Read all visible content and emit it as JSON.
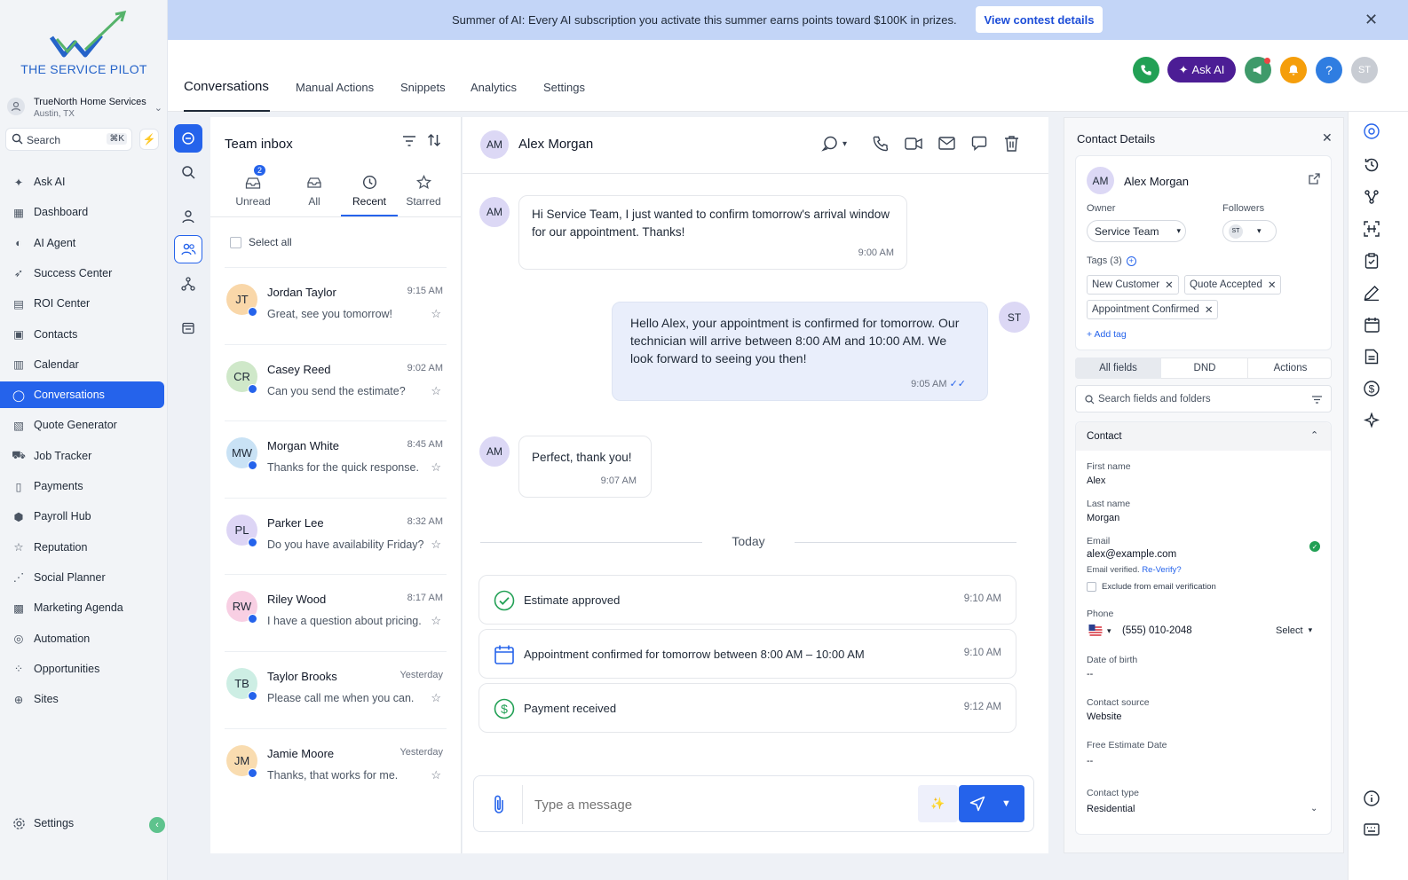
{
  "brand": {
    "name": "THE SERVICE PILOT"
  },
  "account": {
    "name": "TrueNorth Home Services",
    "location": "Austin, TX"
  },
  "sidebar": {
    "search_label": "Search",
    "search_shortcut": "⌘K",
    "items": [
      {
        "label": "Ask AI",
        "icon": "sparkle-icon"
      },
      {
        "label": "Dashboard",
        "icon": "grid-icon"
      },
      {
        "label": "AI Agent",
        "icon": "ai-agent-icon"
      },
      {
        "label": "Success Center",
        "icon": "rocket-icon"
      },
      {
        "label": "ROI Center",
        "icon": "chart-icon"
      },
      {
        "label": "Contacts",
        "icon": "contacts-icon"
      },
      {
        "label": "Calendar",
        "icon": "calendar-icon"
      },
      {
        "label": "Conversations",
        "icon": "chat-icon"
      },
      {
        "label": "Quote Generator",
        "icon": "quote-icon"
      },
      {
        "label": "Job Tracker",
        "icon": "truck-icon"
      },
      {
        "label": "Payments",
        "icon": "receipt-icon"
      },
      {
        "label": "Payroll Hub",
        "icon": "payroll-icon"
      },
      {
        "label": "Reputation",
        "icon": "star-icon"
      },
      {
        "label": "Social Planner",
        "icon": "share-icon"
      },
      {
        "label": "Marketing Agenda",
        "icon": "building-icon"
      },
      {
        "label": "Automation",
        "icon": "automation-icon"
      },
      {
        "label": "Opportunities",
        "icon": "opportunities-icon"
      },
      {
        "label": "Sites",
        "icon": "globe-icon"
      }
    ],
    "settings_label": "Settings"
  },
  "banner": {
    "message": "Summer of AI: Every AI subscription you activate this summer earns points toward $100K in prizes.",
    "cta": "View contest details"
  },
  "topnav": {
    "tabs": [
      "Conversations",
      "Manual Actions",
      "Snippets",
      "Analytics",
      "Settings"
    ],
    "ask_ai": "Ask AI",
    "user_initials": "ST",
    "colors": {
      "phone": "#22a055",
      "askai": "#4c1d95",
      "megaphone": "#3f9a6a",
      "bell": "#f59e0b",
      "help": "#2f7de1"
    }
  },
  "inbox": {
    "title": "Team inbox",
    "tabs": [
      {
        "label": "Unread",
        "badge": "2"
      },
      {
        "label": "All"
      },
      {
        "label": "Recent"
      },
      {
        "label": "Starred"
      }
    ],
    "select_all": "Select all",
    "conversations": [
      {
        "initials": "JT",
        "name": "Jordan Taylor",
        "time": "9:15 AM",
        "preview": "Great, see you tomorrow!",
        "color": "#f9d7a9"
      },
      {
        "initials": "CR",
        "name": "Casey Reed",
        "time": "9:02 AM",
        "preview": "Can you send the estimate?",
        "color": "#cfe8c9"
      },
      {
        "initials": "MW",
        "name": "Morgan White",
        "time": "8:45 AM",
        "preview": "Thanks for the quick response.",
        "color": "#c9e2f5"
      },
      {
        "initials": "PL",
        "name": "Parker Lee",
        "time": "8:32 AM",
        "preview": "Do you have availability Friday?",
        "color": "#ddd5f5"
      },
      {
        "initials": "RW",
        "name": "Riley Wood",
        "time": "8:17 AM",
        "preview": "I have a question about pricing.",
        "color": "#f8cfe3"
      },
      {
        "initials": "TB",
        "name": "Taylor Brooks",
        "time": "Yesterday",
        "preview": "Please call me when you can.",
        "color": "#cdeee4"
      },
      {
        "initials": "JM",
        "name": "Jamie Moore",
        "time": "Yesterday",
        "preview": "Thanks, that works for me.",
        "color": "#f9dcb0"
      }
    ]
  },
  "chat": {
    "contact_initials": "AM",
    "contact_name": "Alex Morgan",
    "agent_initials": "ST",
    "messages": [
      {
        "dir": "in",
        "text": "Hi Service Team, I just wanted to confirm tomorrow's arrival window for our appointment. Thanks!",
        "time": "9:00 AM"
      },
      {
        "dir": "out",
        "text": "Hello Alex, your appointment is confirmed for tomorrow. Our technician will arrive between 8:00 AM and 10:00 AM. We look forward to seeing you then!",
        "time": "9:05 AM"
      },
      {
        "dir": "in",
        "text": "Perfect, thank you!",
        "time": "9:07 AM"
      }
    ],
    "divider": "Today",
    "events": [
      {
        "text": "Estimate approved",
        "time": "9:10 AM",
        "icon": "check-circle-icon"
      },
      {
        "text": "Appointment confirmed for tomorrow between 8:00 AM – 10:00 AM",
        "time": "9:10 AM",
        "icon": "calendar-icon"
      },
      {
        "text": "Payment received",
        "time": "9:12 AM",
        "icon": "dollar-circle-icon"
      }
    ],
    "composer_placeholder": "Type a message"
  },
  "contact": {
    "title": "Contact Details",
    "initials": "AM",
    "name": "Alex Morgan",
    "owner_label": "Owner",
    "owner_value": "Service Team",
    "followers_label": "Followers",
    "followers_initials": "ST",
    "tags_label": "Tags (3)",
    "tags": [
      "New Customer",
      "Quote Accepted",
      "Appointment Confirmed"
    ],
    "add_tag": "+ Add tag",
    "tabs": [
      "All fields",
      "DND",
      "Actions"
    ],
    "search_placeholder": "Search fields and folders",
    "section": "Contact",
    "first_name_label": "First name",
    "first_name": "Alex",
    "last_name_label": "Last name",
    "last_name": "Morgan",
    "email_label": "Email",
    "email": "alex@example.com",
    "email_verified": "Email verified.",
    "reverify": "Re-Verify?",
    "exclude_label": "Exclude from email verification",
    "phone_label": "Phone",
    "phone": "(555) 010-2048",
    "phone_select": "Select",
    "dob_label": "Date of birth",
    "dob": "--",
    "source_label": "Contact source",
    "source": "Website",
    "estimate_label": "Free Estimate Date",
    "estimate": "--",
    "type_label": "Contact type",
    "type": "Residential"
  }
}
